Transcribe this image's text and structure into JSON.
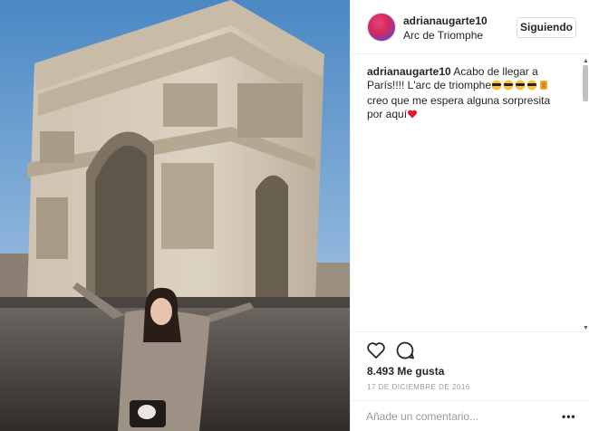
{
  "post": {
    "username": "adrianaugarte10",
    "location": "Arc de Triomphe",
    "follow_label": "Siguiendo",
    "caption_user": "adrianaugarte10",
    "caption_part1": " Acabo de llegar a París!!!! L'arc de triomphe",
    "caption_part2": " creo que me espera alguna sorpresita por aquí",
    "likes": "8.493 Me gusta",
    "date": "17 DE DICIEMBRE DE 2016",
    "comment_placeholder": "Añade un comentario...",
    "more_label": "•••"
  },
  "colors": {
    "sky_top": "#4f8fc9",
    "sky_bottom": "#a8c7e2",
    "stone": "#d7ccbb",
    "ground": "#3b3835",
    "heart": "#ed4956"
  },
  "icons": {
    "like": "heart-outline-icon",
    "comment": "speech-bubble-icon",
    "caption_emojis": [
      "sunglasses-icon",
      "sunglasses-icon",
      "sunglasses-icon",
      "sunglasses-icon",
      "flexed-arm-icon",
      "red-heart-icon"
    ]
  }
}
